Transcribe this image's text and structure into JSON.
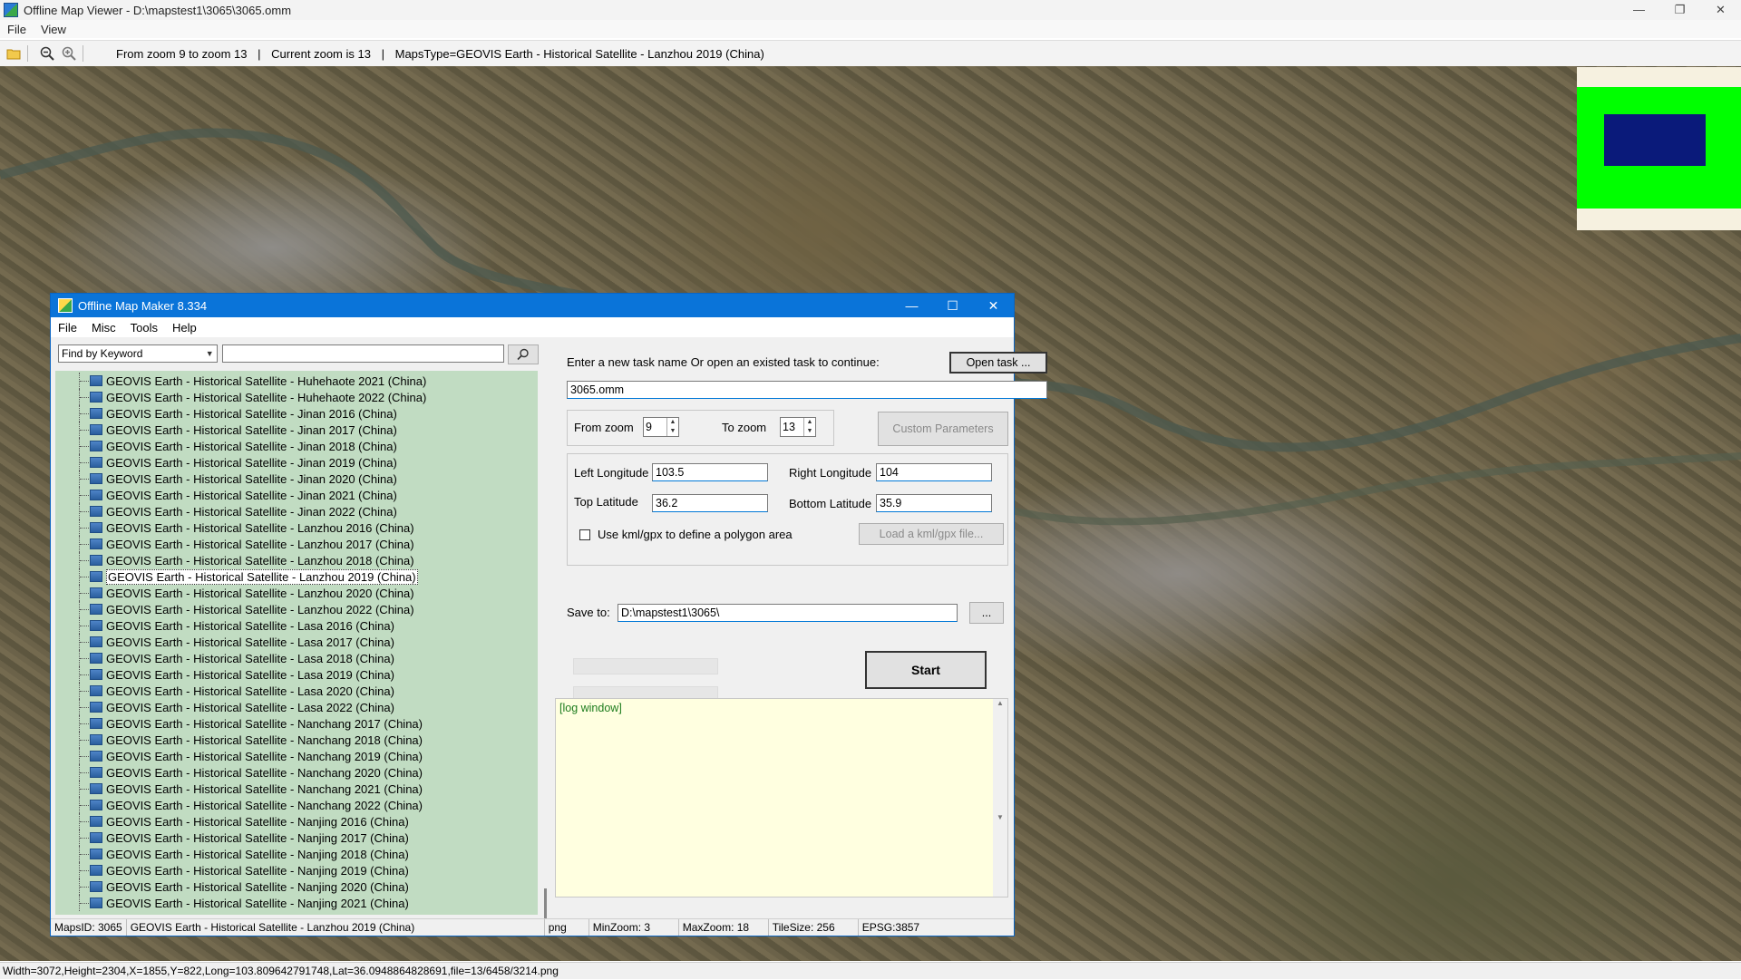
{
  "window": {
    "title": "Offline Map Viewer - D:\\mapstest1\\3065\\3065.omm",
    "controls": [
      "—",
      "❐",
      "✕"
    ]
  },
  "menu": [
    "File",
    "View"
  ],
  "toolbar": {
    "zoom_range": "From zoom 9 to zoom 13",
    "current_zoom": "Current zoom is 13",
    "maps_type": "MapsType=GEOVIS Earth - Historical Satellite - Lanzhou 2019 (China)"
  },
  "status_bar": "Width=3072,Height=2304,X=1855,Y=822,Long=103.809642791748,Lat=36.0948864828691,file=13/6458/3214.png",
  "dialog": {
    "title": "Offline Map Maker 8.334",
    "controls": [
      "—",
      "☐",
      "✕"
    ],
    "menu": [
      "File",
      "Misc",
      "Tools",
      "Help"
    ],
    "search": {
      "mode": "Find by Keyword",
      "keyword": ""
    },
    "tree_items": [
      "GEOVIS Earth - Historical Satellite - Huhehaote 2021 (China)",
      "GEOVIS Earth - Historical Satellite - Huhehaote 2022 (China)",
      "GEOVIS Earth - Historical Satellite - Jinan 2016 (China)",
      "GEOVIS Earth - Historical Satellite - Jinan 2017 (China)",
      "GEOVIS Earth - Historical Satellite - Jinan 2018 (China)",
      "GEOVIS Earth - Historical Satellite - Jinan 2019 (China)",
      "GEOVIS Earth - Historical Satellite - Jinan 2020 (China)",
      "GEOVIS Earth - Historical Satellite - Jinan 2021 (China)",
      "GEOVIS Earth - Historical Satellite - Jinan 2022 (China)",
      "GEOVIS Earth - Historical Satellite - Lanzhou 2016 (China)",
      "GEOVIS Earth - Historical Satellite - Lanzhou 2017 (China)",
      "GEOVIS Earth - Historical Satellite - Lanzhou 2018 (China)",
      "GEOVIS Earth - Historical Satellite - Lanzhou 2019 (China)",
      "GEOVIS Earth - Historical Satellite - Lanzhou 2020 (China)",
      "GEOVIS Earth - Historical Satellite - Lanzhou 2022 (China)",
      "GEOVIS Earth - Historical Satellite - Lasa 2016 (China)",
      "GEOVIS Earth - Historical Satellite - Lasa 2017 (China)",
      "GEOVIS Earth - Historical Satellite - Lasa 2018 (China)",
      "GEOVIS Earth - Historical Satellite - Lasa 2019 (China)",
      "GEOVIS Earth - Historical Satellite - Lasa 2020 (China)",
      "GEOVIS Earth - Historical Satellite - Lasa 2022 (China)",
      "GEOVIS Earth - Historical Satellite - Nanchang 2017 (China)",
      "GEOVIS Earth - Historical Satellite - Nanchang 2018 (China)",
      "GEOVIS Earth - Historical Satellite - Nanchang 2019 (China)",
      "GEOVIS Earth - Historical Satellite - Nanchang 2020 (China)",
      "GEOVIS Earth - Historical Satellite - Nanchang 2021 (China)",
      "GEOVIS Earth - Historical Satellite - Nanchang 2022 (China)",
      "GEOVIS Earth - Historical Satellite - Nanjing 2016 (China)",
      "GEOVIS Earth - Historical Satellite - Nanjing 2017 (China)",
      "GEOVIS Earth - Historical Satellite - Nanjing 2018 (China)",
      "GEOVIS Earth - Historical Satellite - Nanjing 2019 (China)",
      "GEOVIS Earth - Historical Satellite - Nanjing 2020 (China)",
      "GEOVIS Earth - Historical Satellite - Nanjing 2021 (China)"
    ],
    "selected_item": "GEOVIS Earth - Historical Satellite - Lanzhou 2019 (China)",
    "task_prompt": "Enter a new task name Or open an existed task to continue:",
    "open_task_label": "Open task ...",
    "task_name": "3065.omm",
    "from_zoom_label": "From zoom",
    "from_zoom": "9",
    "to_zoom_label": "To zoom",
    "to_zoom": "13",
    "custom_params_label": "Custom Parameters",
    "left_lon_label": "Left Longitude",
    "left_lon": "103.5",
    "right_lon_label": "Right Longitude",
    "right_lon": "104",
    "top_lat_label": "Top Latitude",
    "top_lat": "36.2",
    "bottom_lat_label": "Bottom Latitude",
    "bottom_lat": "35.9",
    "kml_label": "Use kml/gpx to define a polygon area",
    "load_kml_label": "Load a kml/gpx file...",
    "save_to_label": "Save to:",
    "save_to": "D:\\mapstest1\\3065\\",
    "browse_label": "...",
    "start_label": "Start",
    "log_text": "[log window]",
    "status": {
      "maps_id": "MapsID: 3065",
      "maps_name": "GEOVIS Earth - Historical Satellite - Lanzhou 2019 (China)",
      "format": "png",
      "min_zoom": "MinZoom: 3",
      "max_zoom": "MaxZoom: 18",
      "tile_size": "TileSize: 256",
      "epsg": "EPSG:3857"
    }
  }
}
